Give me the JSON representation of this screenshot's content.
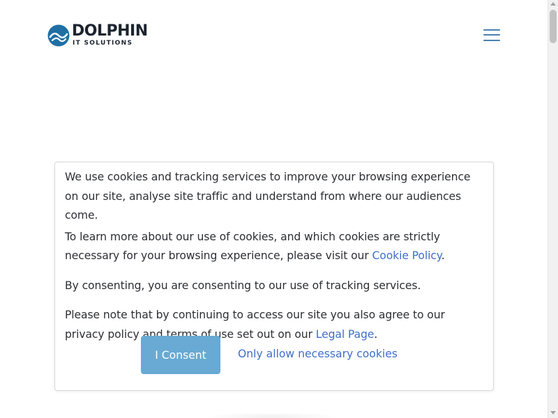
{
  "header": {
    "logo": {
      "name": "DOLPHIN",
      "subtitle": "IT SOLUTIONS",
      "icon": "dolphin-wave-logo-icon"
    },
    "menu_icon": "hamburger-menu-icon"
  },
  "cookie_notice": {
    "paragraph1": "We use cookies and tracking services to improve your browsing experience on our site, analyse site traffic and understand from where our audiences come.",
    "paragraph2_before": "To learn more about our use of cookies, and which cookies are strictly necessary for your browsing experience, please visit our ",
    "paragraph2_link": "Cookie Policy",
    "paragraph2_after": ".",
    "paragraph3": "By consenting, you are consenting to our use of tracking services.",
    "paragraph4_before": "Please note that by continuing to access our site you also agree to our privacy policy and terms of use set out on our ",
    "paragraph4_link": "Legal Page",
    "paragraph4_after": ".",
    "consent_label": "I Consent",
    "necessary_label": "Only allow necessary cookies"
  },
  "colors": {
    "brand_dark": "#1c2430",
    "logo_blue": "#1f6fa5",
    "link_blue": "#3f6fc9",
    "consent_button": "#68aad3",
    "necessary_link": "#dd4a5a",
    "menu_icon": "#4a7fb0"
  }
}
